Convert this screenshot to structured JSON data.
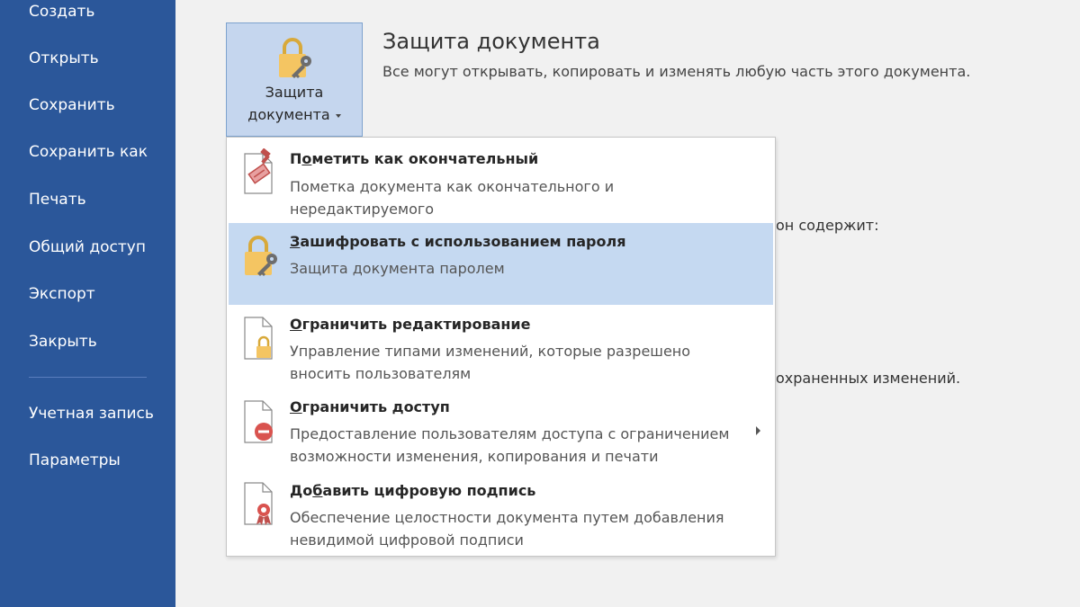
{
  "sidebar": {
    "items": [
      "Создать",
      "Открыть",
      "Сохранить",
      "Сохранить как",
      "Печать",
      "Общий доступ",
      "Экспорт",
      "Закрыть"
    ],
    "bottom_items": [
      "Учетная запись",
      "Параметры"
    ]
  },
  "protect_button": {
    "line1": "Защита",
    "line2": "документа"
  },
  "section": {
    "title": "Защита документа",
    "description": "Все могут открывать, копировать и изменять любую часть этого документа."
  },
  "background_text": {
    "partial1": "он содержит:",
    "partial2": "охраненных изменений."
  },
  "menu": {
    "items": [
      {
        "prefix": "П",
        "hotkey": "о",
        "rest": "метить как окончательный",
        "desc_line1": "Пометка документа как окончательного и",
        "desc_line2": "нередактируемого",
        "icon": "final-stamp-icon"
      },
      {
        "prefix": "",
        "hotkey": "З",
        "rest": "ашифровать с использованием пароля",
        "desc_line1": "Защита документа паролем",
        "desc_line2": "",
        "icon": "lock-key-icon"
      },
      {
        "prefix": "",
        "hotkey": "О",
        "rest": "граничить редактирование",
        "desc_line1": "Управление типами изменений, которые разрешено",
        "desc_line2": "вносить пользователям",
        "icon": "restrict-edit-icon"
      },
      {
        "prefix": "",
        "hotkey": "О",
        "rest": "граничить доступ",
        "desc_line1": "Предоставление пользователям доступа с ограничением",
        "desc_line2": "возможности изменения, копирования и печати",
        "icon": "restrict-access-icon"
      },
      {
        "prefix": "До",
        "hotkey": "б",
        "rest": "авить цифровую подпись",
        "desc_line1": "Обеспечение целостности документа путем добавления",
        "desc_line2": "невидимой цифровой подписи",
        "icon": "digital-signature-icon"
      }
    ]
  },
  "colors": {
    "sidebar": "#2b579a",
    "highlight": "#c5d9f1",
    "lock": "#f4c562"
  }
}
